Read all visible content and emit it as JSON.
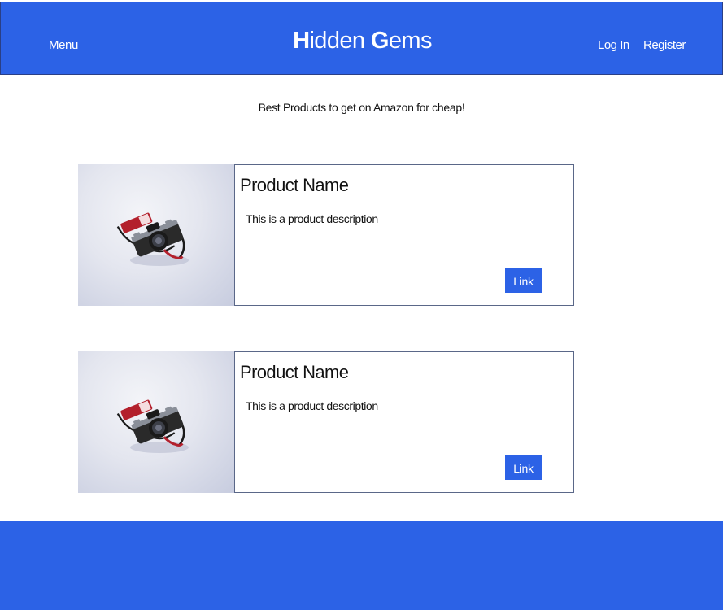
{
  "header": {
    "menu_label": "Menu",
    "brand_first_initial": "H",
    "brand_first_rest": "idden",
    "brand_second_initial": "G",
    "brand_second_rest": "ems",
    "login_label": "Log In",
    "register_label": "Register"
  },
  "tagline": "Best Products to get on Amazon for cheap!",
  "products": [
    {
      "name": "Product Name",
      "description": "This is a product description",
      "link_label": "Link",
      "image_icon": "camera-icon"
    },
    {
      "name": "Product Name",
      "description": "This is a product description",
      "link_label": "Link",
      "image_icon": "camera-icon"
    }
  ],
  "colors": {
    "brand_blue": "#2c62e6",
    "card_border": "#5a6788",
    "strap_red": "#b3202c"
  }
}
